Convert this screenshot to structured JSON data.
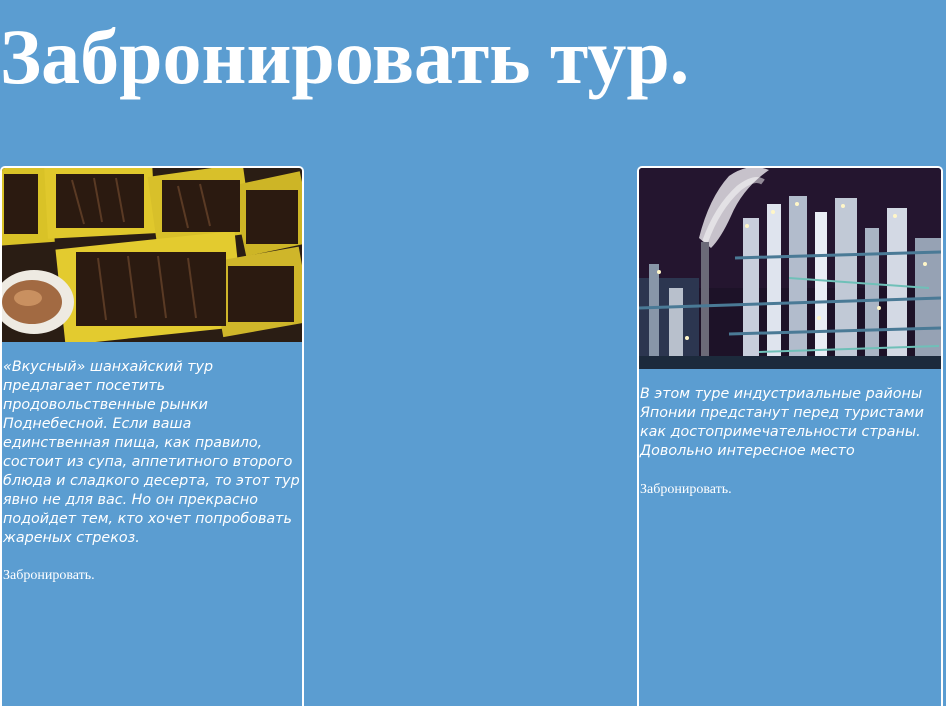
{
  "page": {
    "title": "Забронировать тур.",
    "background_color": "#5b9dd1"
  },
  "tours": [
    {
      "image_subject": "food-market-photo",
      "description": "«Вкусный» шанхайский тур предлагает посетить продовольственные рынки Поднебесной. Если ваша единственная пища, как правило, состоит из супа, аппетитного второго блюда и сладкого десерта, то этот тур явно не для вас. Но он прекрасно подойдет тем, кто хочет попробовать жареных стрекоз.",
      "link_label": "Забронировать."
    },
    {
      "image_subject": "industrial-plant-night-photo",
      "description": "В этом туре индустриальные районы Японии предстанут перед туристами как достопримечательности страны. Довольно интересное место",
      "link_label": "Забронировать."
    }
  ]
}
